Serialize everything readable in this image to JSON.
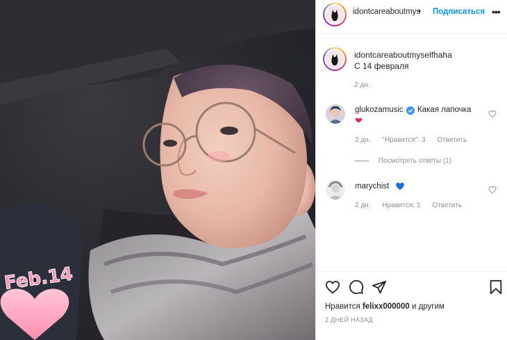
{
  "header": {
    "username": "idontcareaboutmys",
    "dot": "•",
    "follow_label": "Подписаться",
    "more_label": "•••"
  },
  "caption": {
    "username": "idontcareaboutmyselfhaha",
    "text": "С 14 февраля",
    "time": "2 дн."
  },
  "comments": [
    {
      "username": "glukozamusic",
      "verified": true,
      "text": "Какая лапочка",
      "emoji": "❤",
      "time": "2 дн.",
      "likes_label": "\"Нравится\": 3",
      "reply_label": "Ответить",
      "view_replies": "Посмотреть ответы (1)"
    },
    {
      "username": "marychist",
      "emoji": "💙",
      "time": "2 дн.",
      "likes_label": "Нравится: 1",
      "reply_label": "Ответить"
    }
  ],
  "actions": {
    "icons": [
      "heart-icon",
      "comment-icon",
      "share-icon",
      "bookmark-icon"
    ],
    "likes_prefix": "Нравится ",
    "likes_user": "felixx000000",
    "likes_suffix": " и другим",
    "date": "2 ДНЕЙ НАЗАД"
  },
  "photo": {
    "sticker_text": "Feb.14"
  },
  "colors": {
    "accent": "#0095f6",
    "text": "#262626",
    "muted": "#8e8e8e",
    "red_heart": "#ed4956",
    "blue_heart": "#1a6fd6"
  }
}
